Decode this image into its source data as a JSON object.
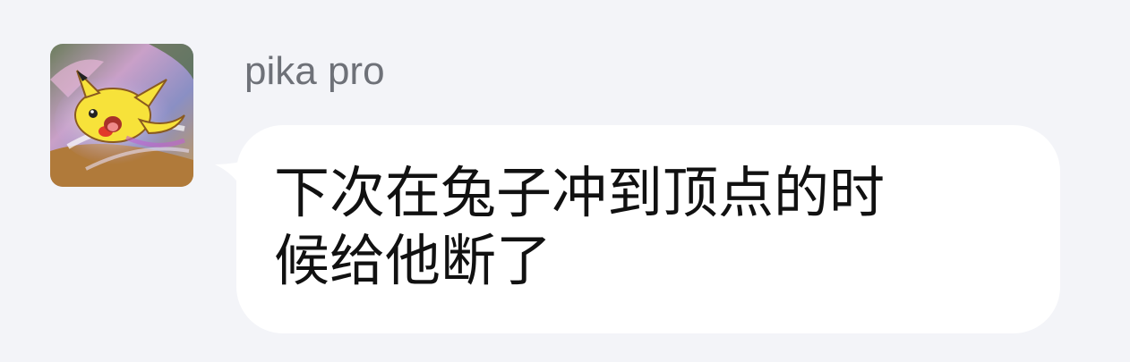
{
  "message": {
    "sender_name": "pika pro",
    "text": "下次在兔子冲到顶点的时候给他断了",
    "avatar_icon": "pikachu-avatar-icon",
    "bubble_color": "#ffffff",
    "background_color": "#f3f4f8",
    "name_color": "#6e7178",
    "text_color": "#111111"
  }
}
